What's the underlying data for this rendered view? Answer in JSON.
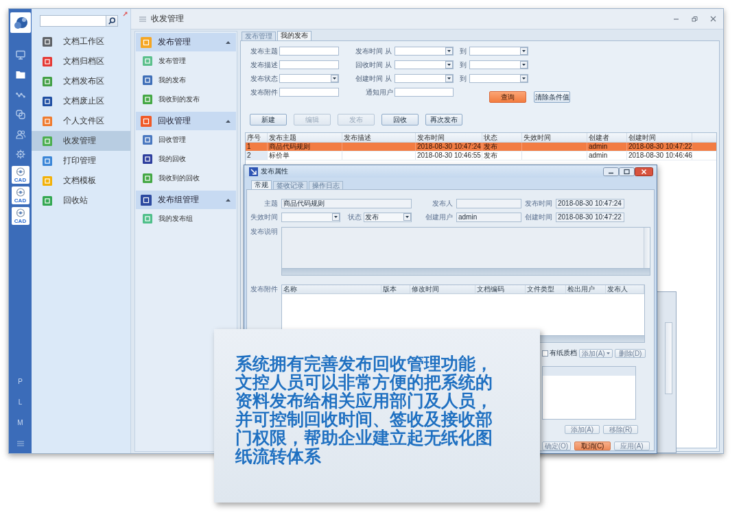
{
  "rail": {
    "items": [
      {
        "kind": "monitor",
        "selected": false
      },
      {
        "kind": "folder",
        "selected": true
      },
      {
        "kind": "network",
        "selected": false
      },
      {
        "kind": "layers",
        "selected": false
      },
      {
        "kind": "users",
        "selected": false
      },
      {
        "kind": "gear",
        "selected": false
      }
    ],
    "apps": [
      {
        "label": "CAD"
      },
      {
        "label": "CAD"
      },
      {
        "label": "CAD"
      }
    ],
    "shortcuts": [
      "P",
      "L",
      "M"
    ]
  },
  "sidebar": {
    "items": [
      {
        "label": "文档工作区",
        "color": "#5f6368",
        "selected": false
      },
      {
        "label": "文档归档区",
        "color": "#e53935",
        "selected": false
      },
      {
        "label": "文档发布区",
        "color": "#43a047",
        "selected": false
      },
      {
        "label": "文档废止区",
        "color": "#1f4fa3",
        "selected": false
      },
      {
        "label": "个人文件区",
        "color": "#ef7b2f",
        "selected": false
      },
      {
        "label": "收发管理",
        "color": "#4caf50",
        "selected": true
      },
      {
        "label": "打印管理",
        "color": "#3b86d8",
        "selected": false
      },
      {
        "label": "文档模板",
        "color": "#f2b10a",
        "selected": false
      },
      {
        "label": "回收站",
        "color": "#34a853",
        "selected": false
      }
    ]
  },
  "window": {
    "title": "收发管理"
  },
  "subnav": {
    "groups": [
      {
        "label": "发布管理",
        "color": "#f5a623",
        "expanded": true,
        "children": [
          {
            "label": "发布管理",
            "color": "#5cc08c"
          },
          {
            "label": "我的发布",
            "color": "#3f6fb8"
          },
          {
            "label": "我收到的发布",
            "color": "#45a845"
          }
        ]
      },
      {
        "label": "回收管理",
        "color": "#f05a28",
        "expanded": true,
        "children": [
          {
            "label": "回收管理",
            "color": "#4a78c0"
          },
          {
            "label": "我的回收",
            "color": "#2e3f9e"
          },
          {
            "label": "我收到的回收",
            "color": "#45a845"
          }
        ]
      },
      {
        "label": "发布组管理",
        "color": "#2d4aa0",
        "expanded": true,
        "children": [
          {
            "label": "我的发布组",
            "color": "#4fbf8a"
          }
        ]
      }
    ]
  },
  "content": {
    "tabs": [
      {
        "label": "发布管理",
        "selected": false
      },
      {
        "label": "我的发布",
        "selected": true
      }
    ],
    "filters": {
      "fields": [
        {
          "label": "发布主题",
          "kind": "text"
        },
        {
          "label": "发布描述",
          "kind": "text"
        },
        {
          "label": "发布状态",
          "kind": "select"
        },
        {
          "label": "发布附件",
          "kind": "text"
        }
      ],
      "ranges": [
        {
          "label": "发布时间",
          "from": "从",
          "to": "到"
        },
        {
          "label": "回收时间",
          "from": "从",
          "to": "到"
        },
        {
          "label": "创建时间",
          "from": "从",
          "to": "到"
        }
      ],
      "notify": {
        "label": "通知用户"
      },
      "buttons": [
        {
          "label": "查询",
          "primary": true
        },
        {
          "label": "清除条件值",
          "primary": false
        }
      ]
    },
    "toolbar": [
      {
        "label": "新建",
        "disabled": false
      },
      {
        "label": "编辑",
        "disabled": true
      },
      {
        "label": "发布",
        "disabled": true
      },
      {
        "label": "回收",
        "disabled": false
      },
      {
        "label": "再次发布",
        "disabled": false
      }
    ],
    "table": {
      "columns": [
        "序号",
        "发布主题",
        "发布描述",
        "发布时间",
        "状态",
        "失效时间",
        "创建者",
        "创建时间"
      ],
      "rows": [
        {
          "selected": true,
          "cells": [
            "1",
            "商品代码规则",
            null,
            "2018-08-30 10:47:24",
            "发布",
            null,
            "admin",
            "2018-08-30 10:47:22"
          ]
        },
        {
          "selected": false,
          "cells": [
            "2",
            "标价单",
            null,
            "2018-08-30 10:46:55",
            "发布",
            null,
            "admin",
            "2018-08-30 10:46:46"
          ]
        }
      ]
    }
  },
  "dialog": {
    "title": "发布属性",
    "tabs": [
      {
        "label": "常规",
        "selected": true
      },
      {
        "label": "签收记录",
        "selected": false
      },
      {
        "label": "操作日志",
        "selected": false
      }
    ],
    "subject": {
      "label": "主题",
      "value": "商品代码规则"
    },
    "publisher": {
      "label": "发布人"
    },
    "publish_time": {
      "label": "发布时间",
      "value": "2018-08-30 10:47:24"
    },
    "expire_time": {
      "label": "失效时间"
    },
    "status": {
      "label": "状态",
      "value": "发布"
    },
    "creator": {
      "label": "创建用户",
      "value": "admin"
    },
    "create_time": {
      "label": "创建时间",
      "value": "2018-08-30 10:47:22"
    },
    "description": {
      "label": "发布说明"
    },
    "attachments": {
      "label": "发布附件",
      "columns": [
        "名称",
        "版本",
        "修改时间",
        "文档编码",
        "文件类型",
        "检出用户",
        "发布人"
      ]
    },
    "paper_copy": {
      "label": "有纸质档",
      "checked": false
    },
    "attachment_buttons": [
      {
        "label": "添加(A)",
        "dropdown": true
      },
      {
        "label": "删除(D)",
        "dropdown": false
      }
    ],
    "list_buttons": [
      {
        "label": "添加(A)"
      },
      {
        "label": "移除(R)"
      }
    ],
    "footer_buttons": [
      {
        "label": "确定(O)",
        "highlighted": false
      },
      {
        "label": "取消(C)",
        "highlighted": true
      },
      {
        "label": "应用(A)",
        "highlighted": false
      }
    ]
  },
  "callout": {
    "text": "系统拥有完善发布回收管理功能，文控人员可以非常方便的把系统的资料发布给相关应用部门及人员，并可控制回收时间、签收及接收部门权限，帮助企业建立起无纸化图纸流转体系"
  }
}
